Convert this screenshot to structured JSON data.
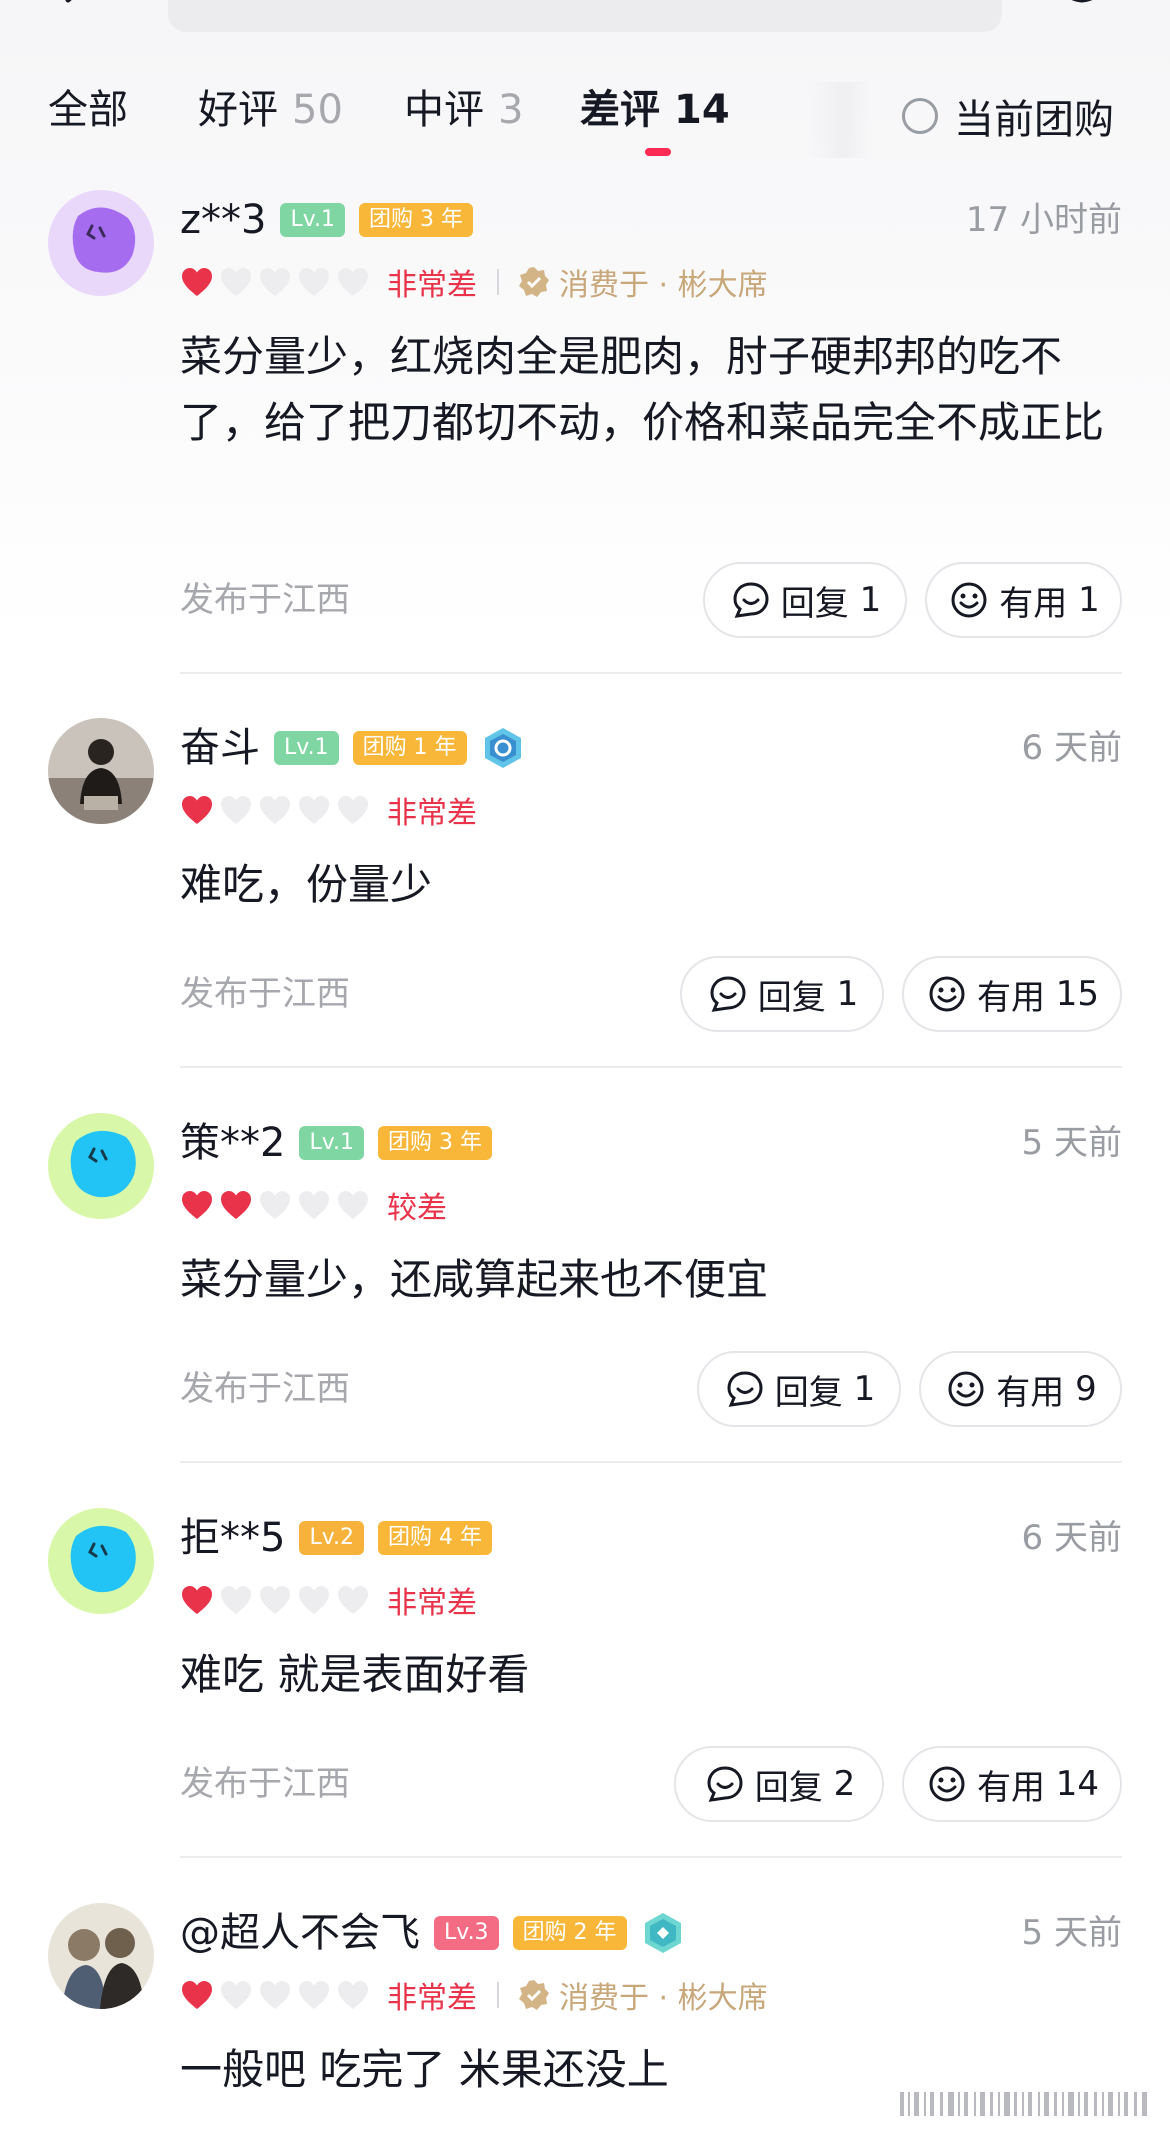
{
  "tabs": [
    {
      "label": "全部",
      "count": ""
    },
    {
      "label": "好评",
      "count": "50"
    },
    {
      "label": "中评",
      "count": "3"
    },
    {
      "label": "差评",
      "count": "14"
    }
  ],
  "filter_label": "当前团购",
  "reviews": [
    {
      "user": "z**3",
      "level": "Lv.1",
      "tuangou": "团购 3 年",
      "time": "17 小时前",
      "rating": 1,
      "rating_text": "非常差",
      "consume": "消费于 · 彬大席",
      "content": "菜分量少，红烧肉全是肥肉，肘子硬邦邦的吃不了，给了把刀都切不动，价格和菜品完全不成正比",
      "location": "发布于江西",
      "reply_label": "回复",
      "reply_count": "1",
      "useful_label": "有用",
      "useful_count": "1"
    },
    {
      "user": "奋斗",
      "level": "Lv.1",
      "tuangou": "团购 1 年",
      "time": "6 天前",
      "rating": 1,
      "rating_text": "非常差",
      "content": "难吃，份量少",
      "location": "发布于江西",
      "reply_label": "回复",
      "reply_count": "1",
      "useful_label": "有用",
      "useful_count": "15"
    },
    {
      "user": "策**2",
      "level": "Lv.1",
      "tuangou": "团购 3 年",
      "time": "5 天前",
      "rating": 2,
      "rating_text": "较差",
      "content": "菜分量少，还咸算起来也不便宜",
      "location": "发布于江西",
      "reply_label": "回复",
      "reply_count": "1",
      "useful_label": "有用",
      "useful_count": "9"
    },
    {
      "user": "拒**5",
      "level": "Lv.2",
      "tuangou": "团购 4 年",
      "time": "6 天前",
      "rating": 1,
      "rating_text": "非常差",
      "content": "难吃 就是表面好看",
      "location": "发布于江西",
      "reply_label": "回复",
      "reply_count": "2",
      "useful_label": "有用",
      "useful_count": "14"
    },
    {
      "user": "@超人不会飞",
      "level": "Lv.3",
      "tuangou": "团购 2 年",
      "time": "5 天前",
      "rating": 1,
      "rating_text": "非常差",
      "consume": "消费于 · 彬大席",
      "content": "一般吧 吃完了 米果还没上"
    }
  ],
  "colors": {
    "accent": "#fe2c55",
    "rating_red": "#e8334a",
    "consume_gold": "#c8a77a",
    "level_green": "#7fd6a2",
    "tuangou_orange": "#f9b73a"
  }
}
